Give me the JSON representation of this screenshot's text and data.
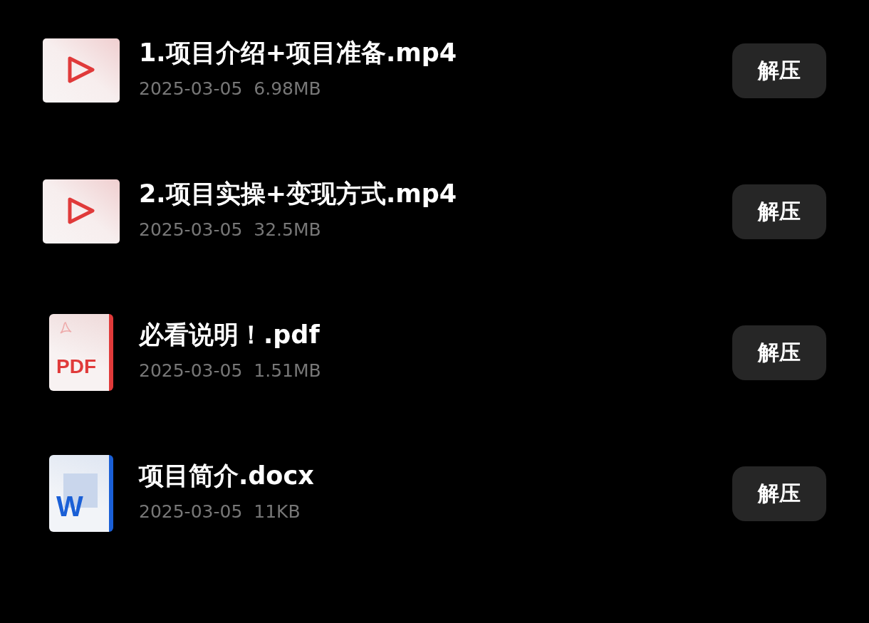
{
  "files": [
    {
      "kind": "video",
      "name": "1.项目介绍+项目准备.mp4",
      "date": "2025-03-05",
      "size": "6.98MB",
      "action": "解压"
    },
    {
      "kind": "video",
      "name": "2.项目实操+变现方式.mp4",
      "date": "2025-03-05",
      "size": "32.5MB",
      "action": "解压"
    },
    {
      "kind": "pdf",
      "icon_label": "PDF",
      "name": "必看说明！.pdf",
      "date": "2025-03-05",
      "size": "1.51MB",
      "action": "解压"
    },
    {
      "kind": "word",
      "icon_label": "W",
      "name": "项目简介.docx",
      "date": "2025-03-05",
      "size": "11KB",
      "action": "解压"
    }
  ]
}
